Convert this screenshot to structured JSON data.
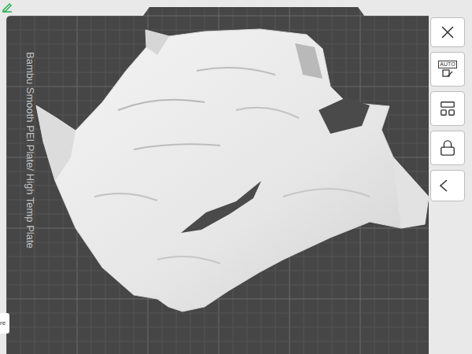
{
  "viewport": {
    "plate_label": "Bambu Smooth PEI Plate/ High Temp Plate",
    "corner_tab": "re"
  },
  "toolbar": {
    "auto_label": "AUTO"
  }
}
